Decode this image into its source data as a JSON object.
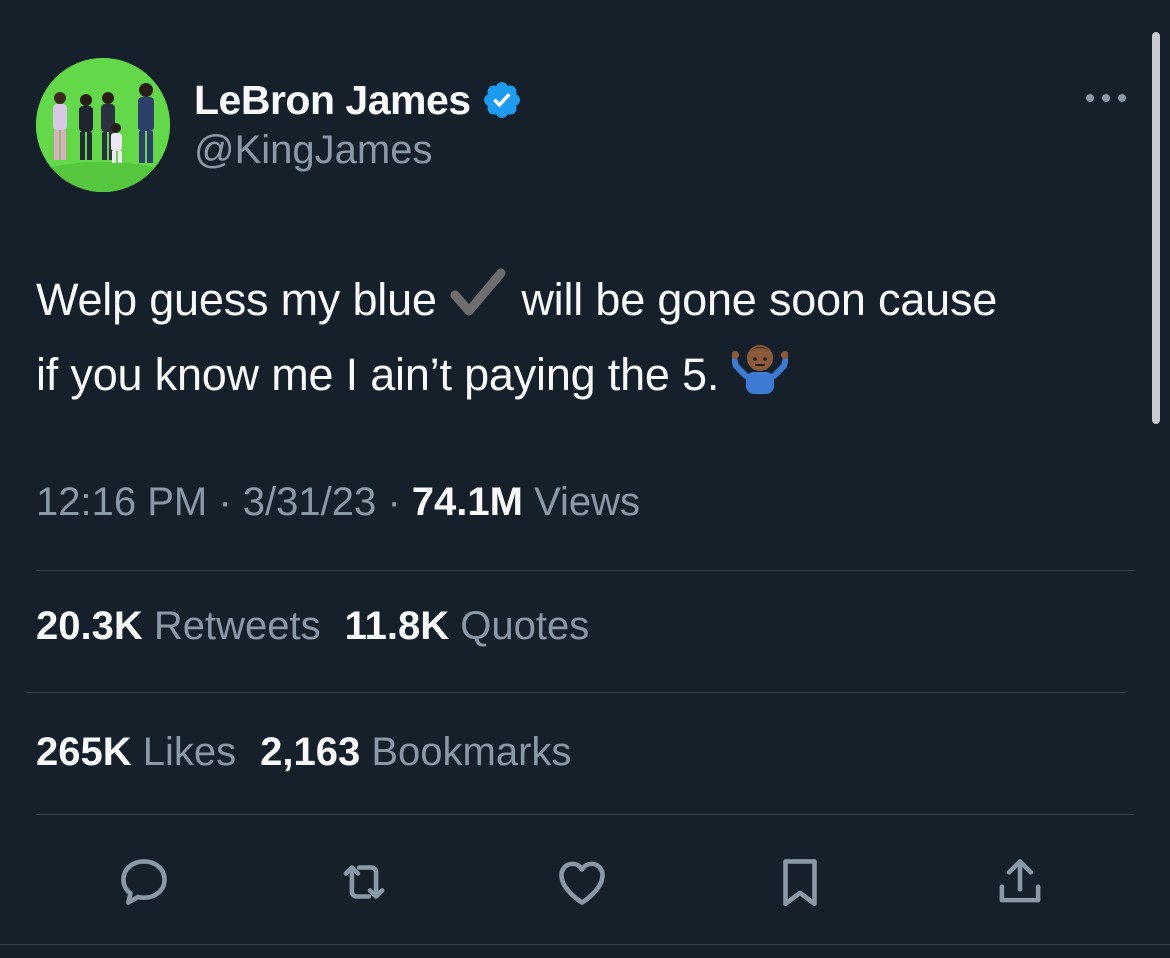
{
  "author": {
    "display_name": "LeBron James",
    "handle": "@KingJames",
    "verified_icon": "verified-badge-icon"
  },
  "tweet": {
    "line1_before": "Welp guess my blue ",
    "line1_after": " will be gone soon cause",
    "line2": "if you know me I ain’t paying the 5.",
    "emoji_checkmark": "heavy-check-mark-emoji",
    "emoji_shrug": "person-shrugging-emoji"
  },
  "meta": {
    "time": "12:16 PM",
    "sep1": " · ",
    "date": "3/31/23",
    "sep2": " · ",
    "views_count": "74.1M",
    "views_label": " Views"
  },
  "stats": {
    "retweets_count": "20.3K",
    "retweets_label": " Retweets",
    "quotes_count": "11.8K",
    "quotes_label": " Quotes",
    "likes_count": "265K",
    "likes_label": " Likes",
    "bookmarks_count": "2,163",
    "bookmarks_label": " Bookmarks"
  },
  "actions": [
    {
      "name": "reply",
      "icon": "reply-icon"
    },
    {
      "name": "retweet",
      "icon": "retweet-icon"
    },
    {
      "name": "like",
      "icon": "heart-icon"
    },
    {
      "name": "bookmark",
      "icon": "bookmark-icon"
    },
    {
      "name": "share",
      "icon": "share-icon"
    }
  ],
  "colors": {
    "background": "#15202b",
    "text_primary": "#f7f9f9",
    "text_secondary": "#8b98a5",
    "divider": "#38444d",
    "verified_blue": "#1d9bf0",
    "avatar_green": "#63d94a"
  }
}
